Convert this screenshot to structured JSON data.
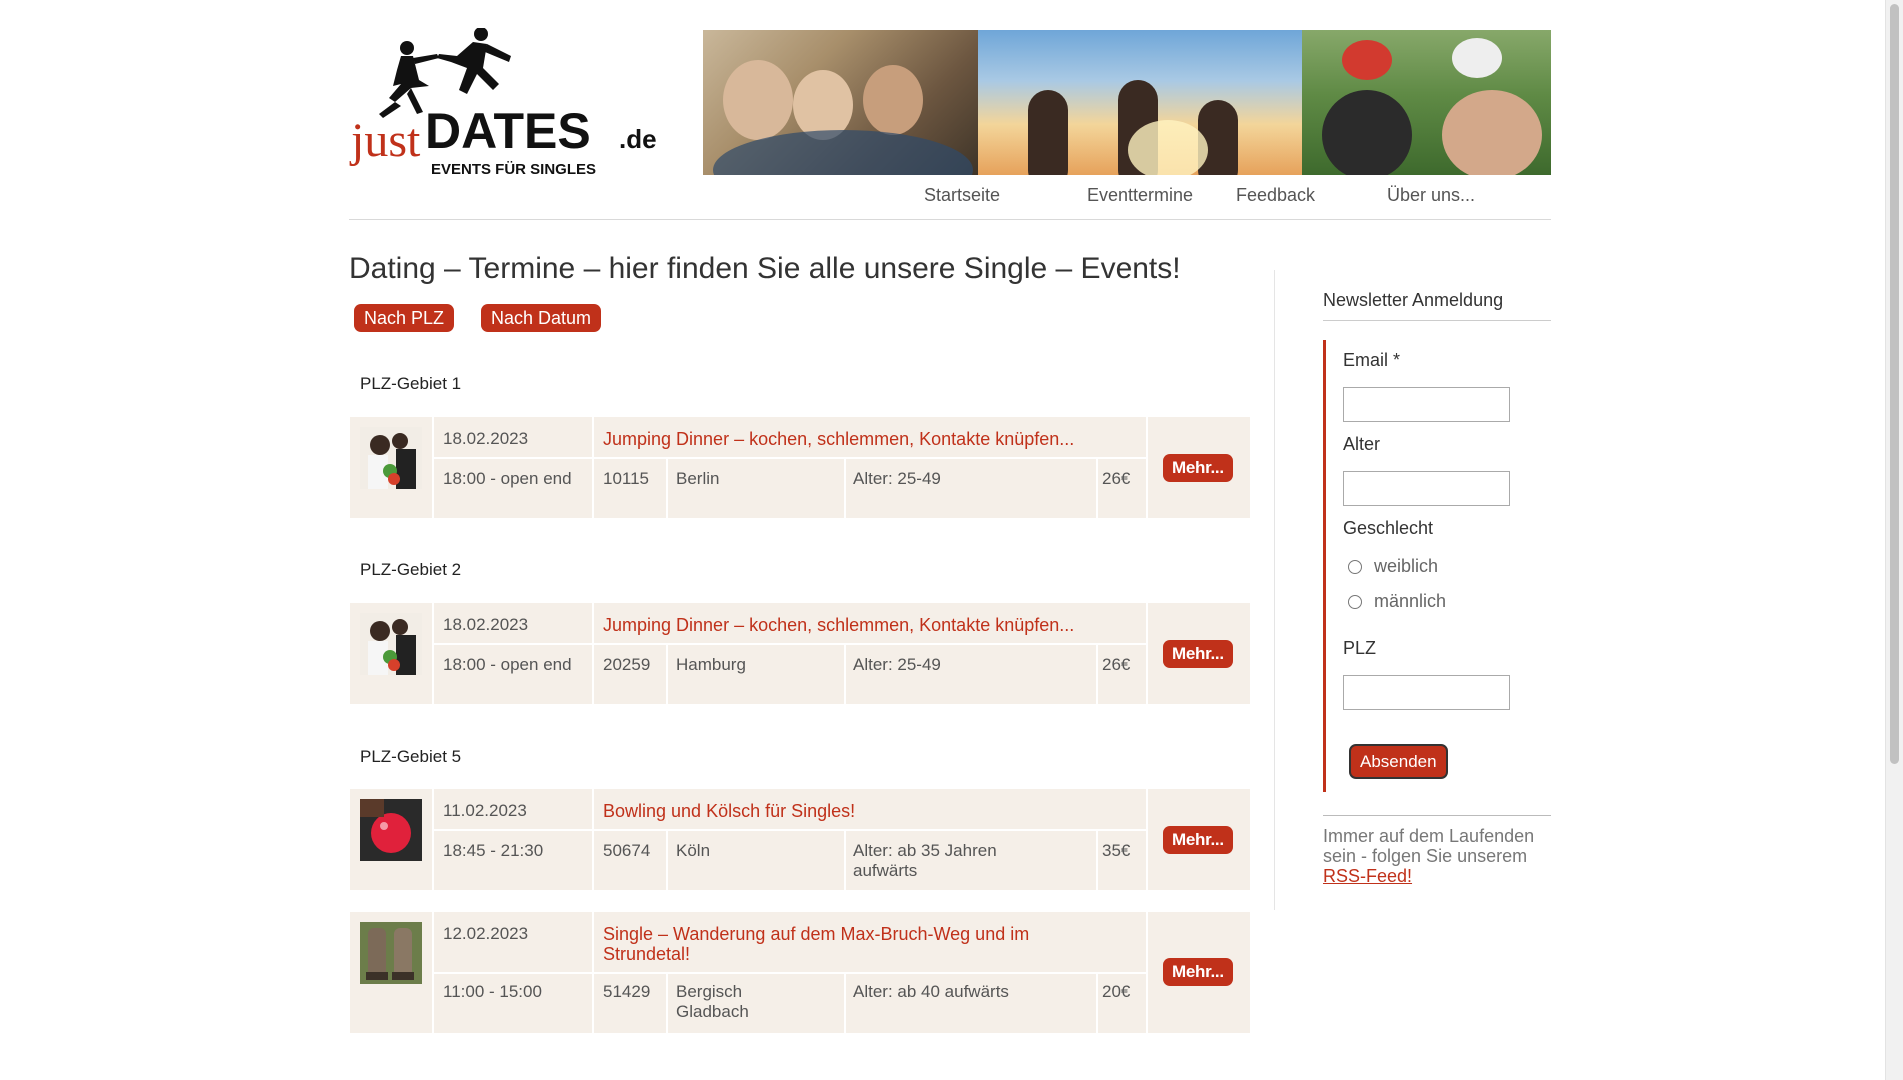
{
  "logo": {
    "brand_pre": "just",
    "brand_main": "DATES",
    "brand_suffix": ".de",
    "tagline": "EVENTS FÜR SINGLES"
  },
  "nav": {
    "items": [
      "Startseite",
      "Eventtermine",
      "Feedback",
      "Über uns..."
    ]
  },
  "main": {
    "title": "Dating – Termine – hier finden Sie alle unsere Single – Events!",
    "filters": [
      "Nach PLZ",
      "Nach Datum"
    ],
    "more_label": "Mehr...",
    "regions": [
      {
        "label": "PLZ-Gebiet 1"
      },
      {
        "label": "PLZ-Gebiet 2"
      },
      {
        "label": "PLZ-Gebiet 5"
      }
    ],
    "events": [
      {
        "date": "18.02.2023",
        "title": "Jumping Dinner – kochen, schlemmen, Kontakte knüpfen...",
        "time": "18:00 - open end",
        "zip": "10115",
        "city": "Berlin",
        "age": "Alter: 25-49",
        "price": "26€",
        "thumb": "dinner-photo"
      },
      {
        "date": "18.02.2023",
        "title": "Jumping Dinner – kochen, schlemmen, Kontakte knüpfen...",
        "time": "18:00 - open end",
        "zip": "20259",
        "city": "Hamburg",
        "age": "Alter: 25-49",
        "price": "26€",
        "thumb": "dinner-photo"
      },
      {
        "date": "11.02.2023",
        "title": "Bowling und Kölsch für Singles!",
        "time": "18:45 - 21:30",
        "zip": "50674",
        "city": "Köln",
        "age": "Alter: ab 35 Jahren aufwärts",
        "price": "35€",
        "thumb": "bowling-ball-photo"
      },
      {
        "date": "12.02.2023",
        "title": "Single – Wanderung auf dem Max-Bruch-Weg und im Strundetal!",
        "time": "11:00 - 15:00",
        "zip": "51429",
        "city": "Bergisch Gladbach",
        "age": "Alter: ab 40 aufwärts",
        "price": "20€",
        "thumb": "hiking-boots-photo"
      }
    ]
  },
  "sidebar": {
    "newsletter_title": "Newsletter Anmeldung",
    "email_label": "Email",
    "required_mark": "*",
    "age_label": "Alter",
    "gender_label": "Geschlecht",
    "gender_options": [
      "weiblich",
      "männlich"
    ],
    "zip_label": "PLZ",
    "submit_label": "Absenden",
    "rss_text": "Immer auf dem Laufenden sein - folgen Sie unserem",
    "rss_link": "RSS-Feed!"
  },
  "colors": {
    "accent": "#c0311a",
    "row_bg": "#f5efe8"
  }
}
